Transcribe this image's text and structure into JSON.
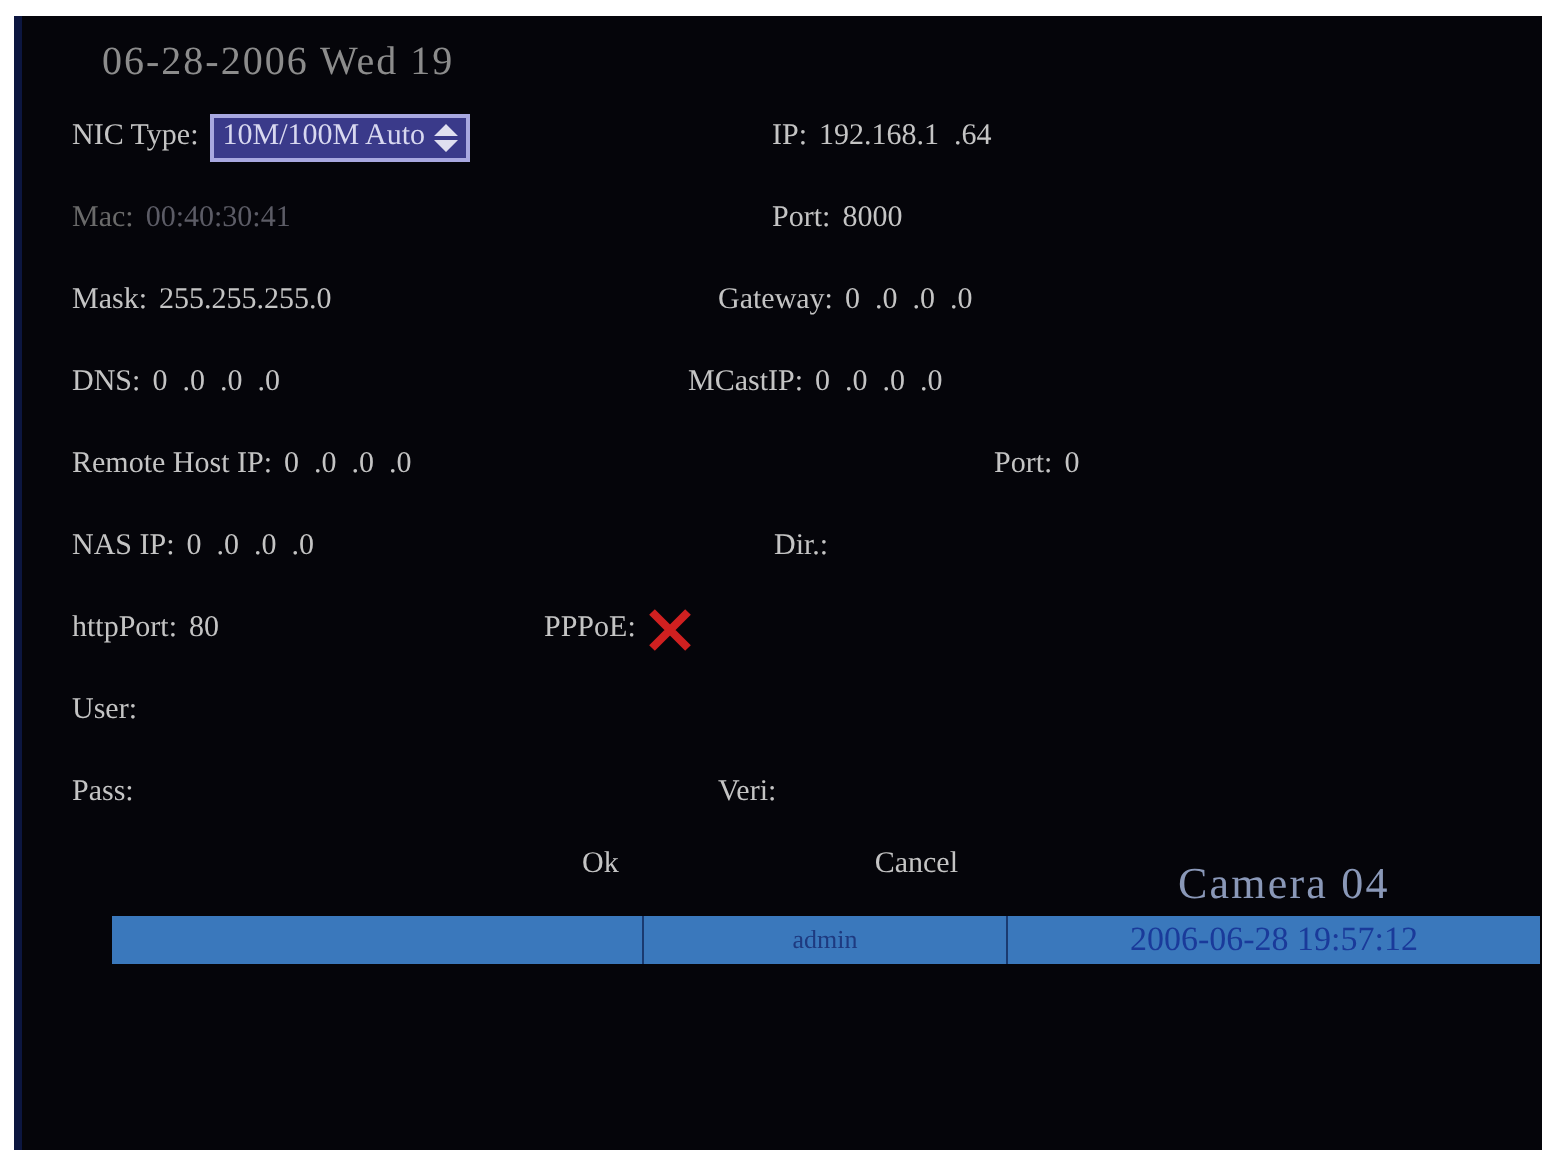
{
  "overlay_datetime": "06-28-2006 Wed 19",
  "rows": [
    [
      {
        "kind": "dropdown",
        "label": "NIC Type:",
        "value": "10M/100M Auto",
        "disabled": false
      },
      {
        "kind": "text",
        "label": "IP:",
        "value": "192.168.1  .64",
        "disabled": false
      }
    ],
    [
      {
        "kind": "text",
        "label": "Mac:",
        "value": "00:40:30:41",
        "disabled": true
      },
      {
        "kind": "text",
        "label": "Port:",
        "value": "8000",
        "disabled": false
      }
    ],
    [
      {
        "kind": "text",
        "label": "Mask:",
        "value": "255.255.255.0",
        "disabled": false
      },
      {
        "kind": "text",
        "label": "Gateway:",
        "value": "0  .0  .0  .0",
        "disabled": false
      }
    ],
    [
      {
        "kind": "text",
        "label": "DNS:",
        "value": "0  .0  .0  .0",
        "disabled": false
      },
      {
        "kind": "text",
        "label": "MCastIP:",
        "value": "0  .0  .0  .0",
        "disabled": false
      }
    ],
    [
      {
        "kind": "text",
        "label": "Remote Host IP:",
        "value": "0  .0  .0  .0",
        "disabled": false
      },
      {
        "kind": "text",
        "label": "Port:",
        "value": "0",
        "disabled": false
      }
    ],
    [
      {
        "kind": "text",
        "label": "NAS IP:",
        "value": "0  .0  .0  .0",
        "disabled": false
      },
      {
        "kind": "text",
        "label": "Dir.:",
        "disabled": false
      }
    ],
    [
      {
        "kind": "text",
        "label": "httpPort:",
        "value": "80",
        "disabled": false
      },
      {
        "kind": "checkbox",
        "label": "PPPoE:",
        "checked": false,
        "disabled": false
      }
    ],
    [
      {
        "kind": "text",
        "label": "User:",
        "disabled": false
      }
    ],
    [
      {
        "kind": "text",
        "label": "Pass:",
        "disabled": false
      },
      {
        "kind": "text",
        "label": "Veri:",
        "disabled": false
      }
    ]
  ],
  "buttons": [
    "Ok",
    "Cancel"
  ],
  "camera_label": "Camera 04",
  "status_bar": {
    "user": "admin",
    "datetime": "2006-06-28 19:57:12"
  }
}
